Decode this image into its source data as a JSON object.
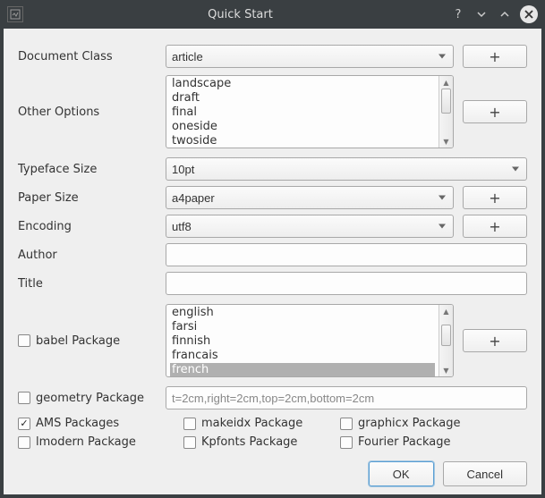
{
  "window": {
    "title": "Quick Start",
    "help": "?",
    "close": "×"
  },
  "labels": {
    "document_class": "Document Class",
    "other_options": "Other Options",
    "typeface_size": "Typeface Size",
    "paper_size": "Paper Size",
    "encoding": "Encoding",
    "author": "Author",
    "title": "Title",
    "babel": "babel Package",
    "geometry": "geometry Package",
    "ams": "AMS Packages",
    "lmodern": "lmodern Package",
    "makeidx": "makeidx Package",
    "kpfonts": "Kpfonts Package",
    "graphicx": "graphicx Package",
    "fourier": "Fourier Package"
  },
  "values": {
    "document_class": "article",
    "typeface_size": "10pt",
    "paper_size": "a4paper",
    "encoding": "utf8",
    "author": "",
    "title": "",
    "geometry_text": "t=2cm,right=2cm,top=2cm,bottom=2cm"
  },
  "other_options": [
    "landscape",
    "draft",
    "final",
    "oneside",
    "twoside"
  ],
  "babel_languages": [
    "english",
    "farsi",
    "finnish",
    "francais",
    "french"
  ],
  "babel_selected_index": 4,
  "checks": {
    "babel": false,
    "geometry": false,
    "ams": true,
    "lmodern": false,
    "makeidx": false,
    "kpfonts": false,
    "graphicx": false,
    "fourier": false
  },
  "buttons": {
    "add": "+",
    "ok": "OK",
    "cancel": "Cancel"
  }
}
